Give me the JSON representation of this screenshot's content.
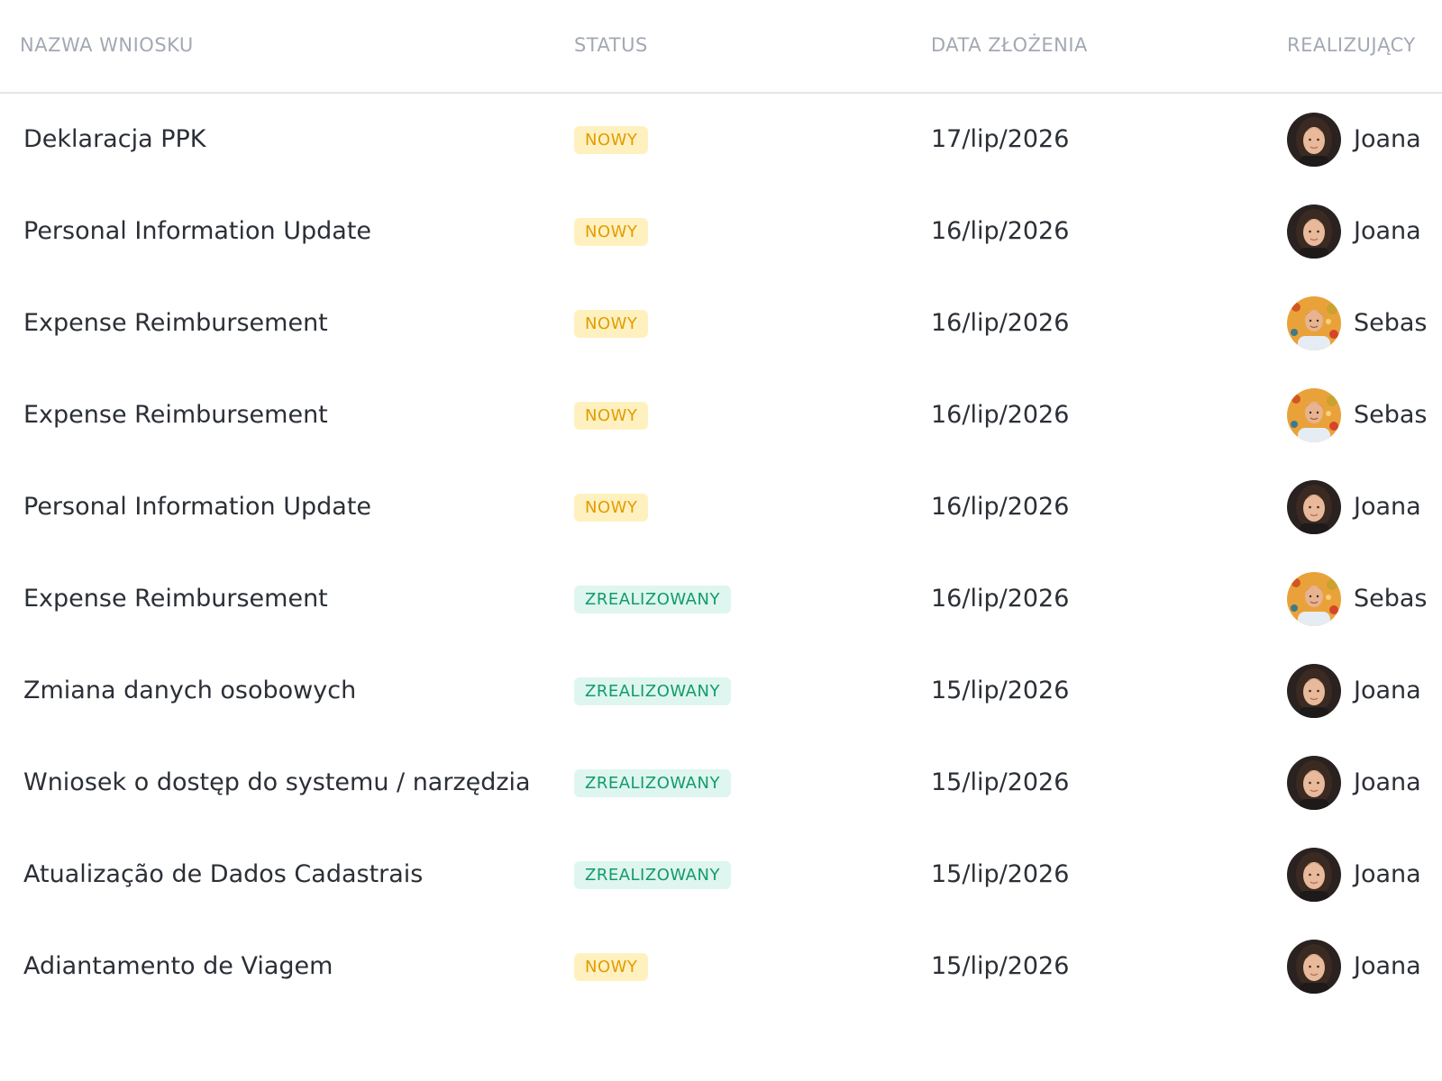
{
  "table": {
    "columns": {
      "name": "NAZWA WNIOSKU",
      "status": "STATUS",
      "date": "DATA ZŁOŻENIA",
      "assignee": "REALIZUJĄCY"
    },
    "status_colors": {
      "nowy_bg": "#fff1bf",
      "nowy_text": "#e39b00",
      "done_bg": "#def6ef",
      "done_text": "#139b6a"
    },
    "rows": [
      {
        "name": "Deklaracja PPK",
        "status": "NOWY",
        "status_kind": "nowy",
        "date": "17/lip/2026",
        "assignee": "Joana",
        "avatar": "woman-avatar-icon"
      },
      {
        "name": "Personal Information Update",
        "status": "NOWY",
        "status_kind": "nowy",
        "date": "16/lip/2026",
        "assignee": "Joana",
        "avatar": "woman-avatar-icon"
      },
      {
        "name": "Expense Reimbursement",
        "status": "NOWY",
        "status_kind": "nowy",
        "date": "16/lip/2026",
        "assignee": "Sebas",
        "avatar": "man-avatar-icon"
      },
      {
        "name": "Expense Reimbursement",
        "status": "NOWY",
        "status_kind": "nowy",
        "date": "16/lip/2026",
        "assignee": "Sebas",
        "avatar": "man-avatar-icon"
      },
      {
        "name": "Personal Information Update",
        "status": "NOWY",
        "status_kind": "nowy",
        "date": "16/lip/2026",
        "assignee": "Joana",
        "avatar": "woman-avatar-icon"
      },
      {
        "name": "Expense Reimbursement",
        "status": "ZREALIZOWANY",
        "status_kind": "done",
        "date": "16/lip/2026",
        "assignee": "Sebas",
        "avatar": "man-avatar-icon"
      },
      {
        "name": "Zmiana danych osobowych",
        "status": "ZREALIZOWANY",
        "status_kind": "done",
        "date": "15/lip/2026",
        "assignee": "Joana",
        "avatar": "woman-avatar-icon"
      },
      {
        "name": "Wniosek o dostęp do systemu / narzędzia",
        "status": "ZREALIZOWANY",
        "status_kind": "done",
        "date": "15/lip/2026",
        "assignee": "Joana",
        "avatar": "woman-avatar-icon"
      },
      {
        "name": "Atualização de Dados Cadastrais",
        "status": "ZREALIZOWANY",
        "status_kind": "done",
        "date": "15/lip/2026",
        "assignee": "Joana",
        "avatar": "woman-avatar-icon"
      },
      {
        "name": "Adiantamento de Viagem",
        "status": "NOWY",
        "status_kind": "nowy",
        "date": "15/lip/2026",
        "assignee": "Joana",
        "avatar": "woman-avatar-icon"
      }
    ]
  }
}
